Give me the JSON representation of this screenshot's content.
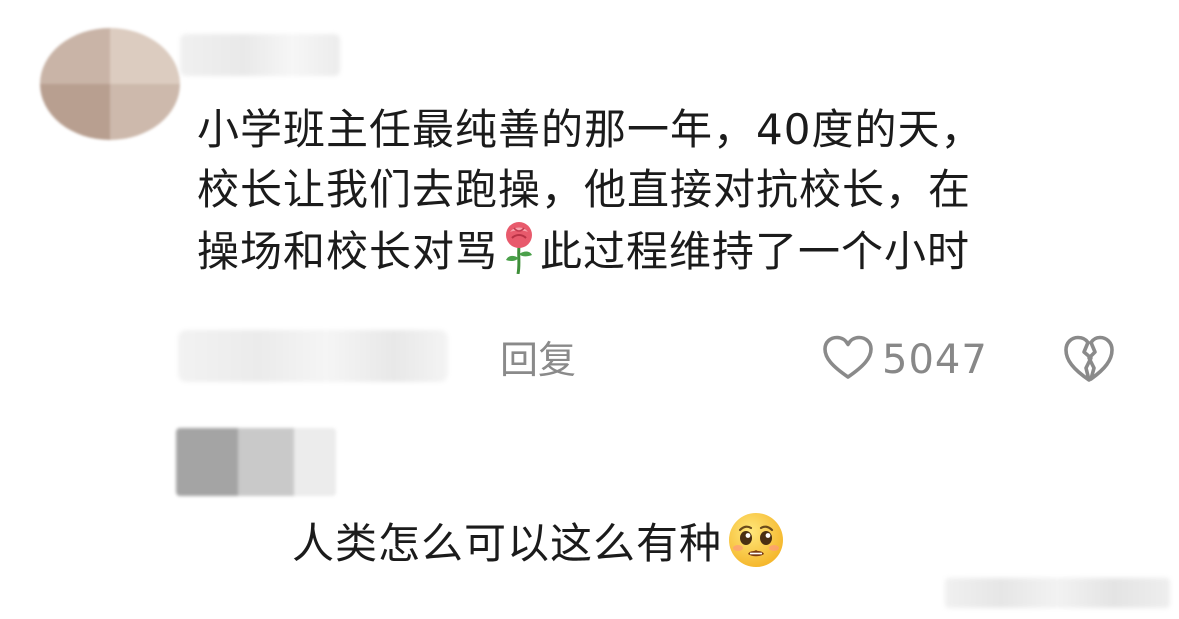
{
  "comment": {
    "lines": [
      "小学班主任最纯善的那一年，40度的天，",
      "校长让我们去跑操，他直接对抗校长，在",
      "操场和校长对骂",
      "此过程维持了一个小时"
    ],
    "inline_emoji": "rose-emoji"
  },
  "actions": {
    "reply_label": "回复",
    "like_count": "5047",
    "like_icon": "heart-outline-icon",
    "dislike_icon": "broken-heart-icon"
  },
  "reply": {
    "text": "人类怎么可以这么有种",
    "emoji": "pleading-face-emoji"
  },
  "colors": {
    "text": "#1b1b1b",
    "meta_gray": "#8a8a8a",
    "background": "#ffffff"
  }
}
